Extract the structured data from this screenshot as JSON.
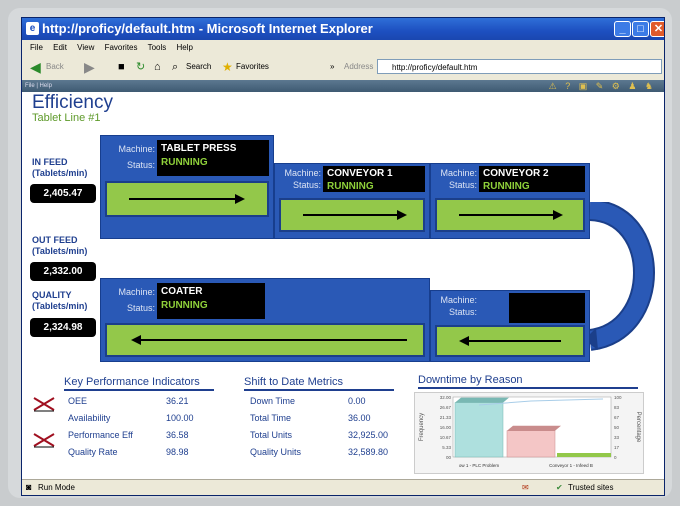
{
  "window": {
    "title": "http://proficy/default.htm - Microsoft Internet Explorer",
    "menu": [
      "File",
      "Edit",
      "View",
      "Favorites",
      "Tools",
      "Help"
    ],
    "toolbar": {
      "back": "Back",
      "search": "Search",
      "favorites": "Favorites"
    },
    "address_label": "Address",
    "address_value": "http://proficy/default.htm",
    "app_menu": "File | Help"
  },
  "page": {
    "title": "Efficiency",
    "subtitle": "Tablet Line #1"
  },
  "side": {
    "infeed_label": "IN FEED",
    "infeed_unit": "(Tablets/min)",
    "infeed_value": "2,405.47",
    "outfeed_label": "OUT FEED",
    "outfeed_unit": "(Tablets/min)",
    "outfeed_value": "2,332.00",
    "quality_label": "QUALITY",
    "quality_unit": "(Tablets/min)",
    "quality_value": "2,324.98"
  },
  "machines": {
    "labels": {
      "machine": "Machine:",
      "status": "Status:"
    },
    "tablet_press": {
      "name": "TABLET PRESS",
      "status": "RUNNING"
    },
    "conveyor1": {
      "name": "CONVEYOR 1",
      "status": "RUNNING"
    },
    "conveyor2": {
      "name": "CONVEYOR 2",
      "status": "RUNNING"
    },
    "coater": {
      "name": "COATER",
      "status": "RUNNING"
    },
    "blank": {
      "name": "",
      "status": ""
    }
  },
  "kpi": {
    "title": "Key Performance Indicators",
    "items": [
      {
        "label": "OEE",
        "value": "36.21"
      },
      {
        "label": "Availability",
        "value": "100.00"
      },
      {
        "label": "Performance Eff",
        "value": "36.58"
      },
      {
        "label": "Quality Rate",
        "value": "98.98"
      }
    ]
  },
  "shift": {
    "title": "Shift to Date Metrics",
    "items": [
      {
        "label": "Down Time",
        "value": "0.00"
      },
      {
        "label": "Total Time",
        "value": "36.00"
      },
      {
        "label": "Total Units",
        "value": "32,925.00"
      },
      {
        "label": "Quality Units",
        "value": "32,589.80"
      }
    ]
  },
  "downtime": {
    "title": "Downtime by Reason",
    "ylabel": "Frequency",
    "y2label": "Percentage",
    "yticks": [
      "32.00",
      "26.67",
      "21.33",
      "16.00",
      "10.67",
      "5.33",
      "00"
    ],
    "y2ticks": [
      "100",
      "83",
      "67",
      "50",
      "33",
      "17",
      "0"
    ],
    "categories": [
      "ow 1 - PLC Problem",
      "Conveyor 1 - Infeed B"
    ]
  },
  "status": {
    "left": "Run Mode",
    "right": "Trusted sites"
  },
  "chart_data": {
    "type": "bar",
    "title": "Downtime by Reason",
    "ylabel": "Frequency",
    "categories": [
      "ow 1 - PLC Problem",
      "Conveyor 1 - Infeed B"
    ],
    "values": [
      29,
      14
    ],
    "ylim": [
      0,
      32
    ],
    "y2label": "Percentage",
    "y2lim": [
      0,
      100
    ]
  },
  "colors": {
    "brand_blue": "#2a59b6",
    "conveyor_green": "#93c84a",
    "running_green": "#8fd13a",
    "title_blue": "#1f3f8f"
  }
}
